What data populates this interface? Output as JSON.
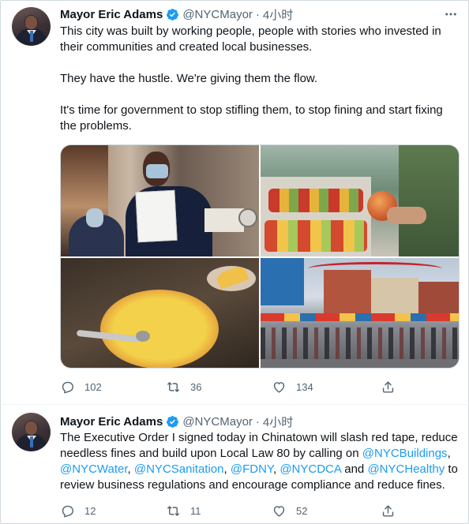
{
  "tweets": [
    {
      "name": "Mayor Eric Adams",
      "handle": "@NYCMayor",
      "dot": "·",
      "time": "4小时",
      "paragraphs": [
        "This city was built by working people, people with stories who invested in their communities and created local businesses.",
        "They have the hustle. We're giving them the flow.",
        "It's time for government to stop stifling them, to stop fining and start fixing the problems."
      ],
      "replies": "102",
      "retweets": "36",
      "likes": "134"
    },
    {
      "name": "Mayor Eric Adams",
      "handle": "@NYCMayor",
      "dot": "·",
      "time": "4小时",
      "text_parts": [
        {
          "t": "The Executive Order I signed today in Chinatown will slash red tape, reduce needless fines and build upon Local Law 80 by calling on ",
          "link": false
        },
        {
          "t": "@NYCBuildings",
          "link": true
        },
        {
          "t": ", ",
          "link": false
        },
        {
          "t": "@NYCWater",
          "link": true
        },
        {
          "t": ", ",
          "link": false
        },
        {
          "t": "@NYCSanitation",
          "link": true
        },
        {
          "t": ", ",
          "link": false
        },
        {
          "t": "@FDNY",
          "link": true
        },
        {
          "t": ", ",
          "link": false
        },
        {
          "t": "@NYCDCA",
          "link": true
        },
        {
          "t": " and ",
          "link": false
        },
        {
          "t": "@NYCHealthy",
          "link": true
        },
        {
          "t": " to review business regulations and encourage compliance and reduce fines.",
          "link": false
        }
      ],
      "replies": "12",
      "retweets": "11",
      "likes": "52"
    }
  ],
  "colors": {
    "link": "#1d9bf0",
    "secondary": "#536471",
    "verified": "#1d9bf0"
  },
  "icons": [
    "more-icon",
    "verified-badge-icon",
    "reply-icon",
    "retweet-icon",
    "like-icon",
    "share-icon"
  ]
}
